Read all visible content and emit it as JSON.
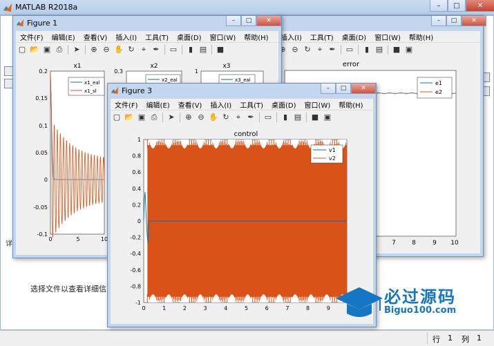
{
  "app": {
    "title": "MATLAB R2018a",
    "select_text": "选择文件以查看详细信息",
    "side_char": "详"
  },
  "status": {
    "row_label": "行",
    "row_value": "1",
    "col_label": "列",
    "col_value": "1"
  },
  "figure_menu": [
    "文件(F)",
    "编辑(E)",
    "查看(V)",
    "插入(I)",
    "工具(T)",
    "桌面(D)",
    "窗口(W)",
    "帮助(H)"
  ],
  "fig1": {
    "title": "Figure 1",
    "x1": {
      "title": "x1",
      "legend": [
        "x1_eal",
        "x1_sl"
      ],
      "yticks": [
        "0.2",
        "0.15",
        "0.1",
        "0.05",
        "0",
        "-0.05",
        "-0.1"
      ],
      "xticks": [
        "0",
        "5",
        "10"
      ]
    },
    "x2": {
      "title": "x2",
      "legend": [
        "x2_eal"
      ],
      "ytick_top": "0.3"
    },
    "x3": {
      "title": "x3",
      "legend": [
        "x3_eal"
      ],
      "ytick_top": "1"
    }
  },
  "fig2": {
    "title": "error",
    "legend": [
      "e1",
      "e2"
    ],
    "xticks": [
      "7",
      "8",
      "9",
      "10"
    ]
  },
  "fig3": {
    "title": "Figure 3",
    "plot_title": "control",
    "legend": [
      "v1",
      "v2"
    ],
    "yticks": [
      "1",
      "0.8",
      "0.6",
      "0.4",
      "0.2",
      "0",
      "-0.2",
      "-0.4",
      "-0.6",
      "-0.8",
      "-1"
    ],
    "xticks": [
      "0",
      "1",
      "2",
      "3",
      "4",
      "5",
      "6",
      "7",
      "8",
      "9"
    ]
  },
  "colors": {
    "series1": "#0072bd",
    "series2": "#d95319",
    "brand": "#1576c4"
  },
  "watermark": {
    "cn": "必过源码",
    "en": "Biguo100.com"
  },
  "chart_data": [
    {
      "type": "line",
      "title": "x1",
      "series": [
        {
          "name": "x1_eal"
        },
        {
          "name": "x1_sl"
        }
      ],
      "ylim": [
        -0.1,
        0.2
      ],
      "xlim": [
        0,
        10
      ]
    },
    {
      "type": "line",
      "title": "error",
      "series": [
        {
          "name": "e1"
        },
        {
          "name": "e2"
        }
      ],
      "xlim": [
        6,
        10
      ]
    },
    {
      "type": "line",
      "title": "control",
      "series": [
        {
          "name": "v1"
        },
        {
          "name": "v2"
        }
      ],
      "ylim": [
        -1,
        1
      ],
      "xlim": [
        0,
        9.9
      ]
    }
  ]
}
